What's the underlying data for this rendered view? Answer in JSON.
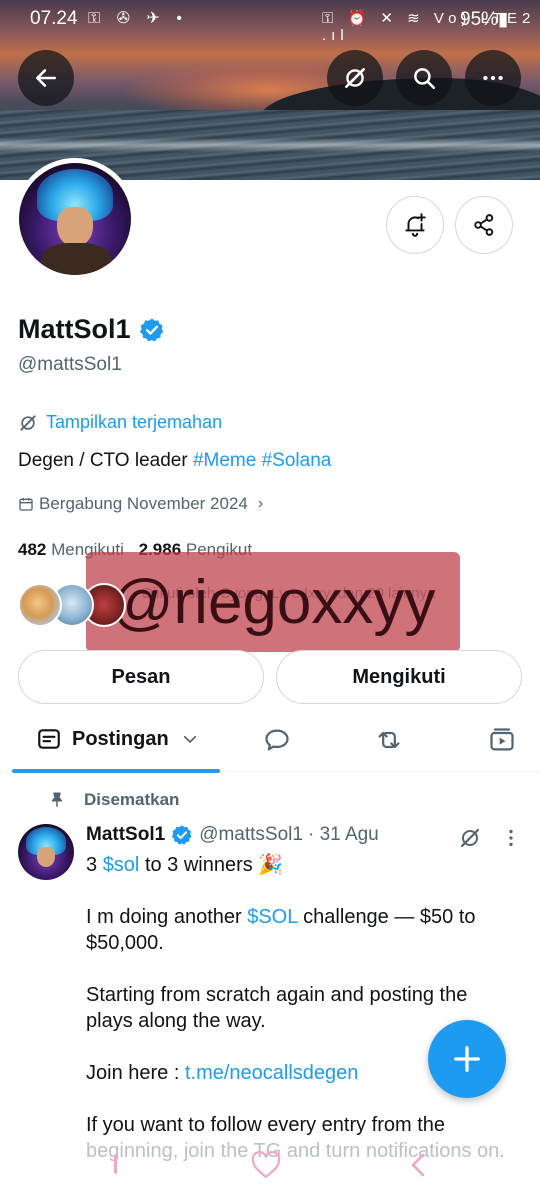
{
  "status_bar": {
    "time": "07.24",
    "left_icons": "⚿ ✇ ✈ •",
    "right_icons": "⚿ ⏰ ✕ ≋ Vo) LTE2 .ıl",
    "battery": "95%▮"
  },
  "header": {
    "back_icon": "arrow-left-icon",
    "grok_icon": "grok-icon",
    "search_icon": "search-icon",
    "more_icon": "more-horizontal-icon"
  },
  "profile": {
    "name": "MattSol1",
    "handle": "@mattsSol1",
    "translate_label": "Tampilkan terjemahan",
    "bio_text": "Degen / CTO leader ",
    "bio_tags": "#Meme #Solana",
    "joined": "Bergabung November 2024",
    "following_count": "482",
    "following_label": "Mengikuti",
    "followers_count": "2.986",
    "followers_label": "Pengikut",
    "followed_by": "Diikuti oleh Cyong, Lyre Ixxy, dan 20 lainnya",
    "watermark": "@riegoxxyy"
  },
  "actions": {
    "message_label": "Pesan",
    "following_button_label": "Mengikuti"
  },
  "tabs": {
    "posts_label": "Postingan"
  },
  "post": {
    "pinned_label": "Disematkan",
    "author_name": "MattSol1",
    "author_handle": "@mattsSol1",
    "date": "· 31 Agu",
    "line1_pre": "3 ",
    "line1_link": "$sol",
    "line1_post": " to 3 winners 🎉",
    "line2_pre": "I m doing another ",
    "line2_link": "$SOL",
    "line2_post": " challenge — $50 to $50,000.",
    "line3": "Starting from scratch again and posting the plays along the way.",
    "line4_pre": "Join here : ",
    "line4_link": "t.me/neocallsdegen",
    "line5": "If you want to follow every entry from the",
    "line6": "beginning, join the TG and turn notifications on."
  },
  "colors": {
    "accent": "#1d9bf0",
    "text": "#0f1419",
    "muted": "#536471"
  }
}
